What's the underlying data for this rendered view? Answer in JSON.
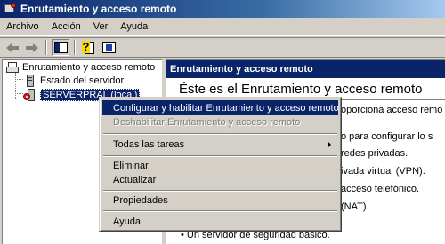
{
  "window": {
    "title": "Enrutamiento y acceso remoto"
  },
  "menubar": {
    "items": [
      "Archivo",
      "Acción",
      "Ver",
      "Ayuda"
    ]
  },
  "toolbar": {
    "icons": [
      "back-icon",
      "forward-icon",
      "show-hide-tree-icon",
      "help-icon",
      "properties-icon"
    ]
  },
  "tree": {
    "root_label": "Enrutamiento y acceso remoto",
    "status_label": "Estado del servidor",
    "server_label": "SERVERPRAL (local)"
  },
  "right_pane": {
    "header": "Enrutamiento y acceso remoto",
    "welcome_title": "Éste es el Enrutamiento y acceso remoto",
    "lines": [
      "oporciona acceso remo",
      "o para configurar lo s",
      "redes privadas.",
      "ivada virtual (VPN).",
      "acceso telefónico.",
      "(NAT).",
      "• Un servidor de seguridad básico."
    ]
  },
  "context_menu": {
    "items": [
      {
        "label": "Configurar y habilitar Enrutamiento y acceso remoto",
        "state": "highlighted"
      },
      {
        "label": "Deshabilitar Enrutamiento y acceso remoto",
        "state": "disabled"
      },
      {
        "label": "Todas las tareas",
        "state": "submenu"
      },
      {
        "label": "Eliminar",
        "state": "normal"
      },
      {
        "label": "Actualizar",
        "state": "normal"
      },
      {
        "label": "Propiedades",
        "state": "normal"
      },
      {
        "label": "Ayuda",
        "state": "normal"
      }
    ]
  },
  "colors": {
    "titlebar": "#0a246a",
    "highlight": "#0a246a",
    "face": "#d4d0c8"
  }
}
